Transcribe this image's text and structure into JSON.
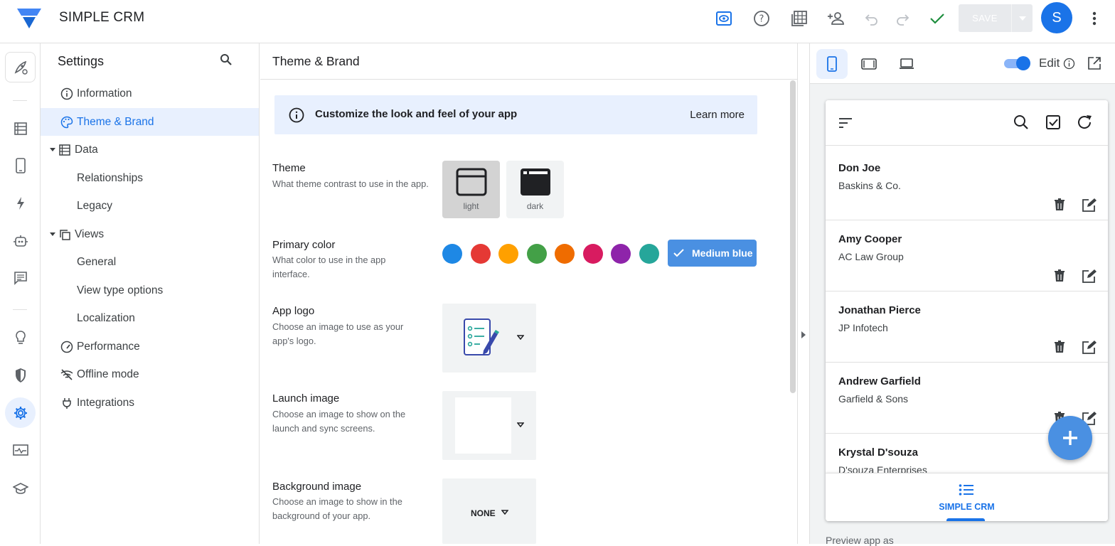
{
  "app": {
    "title": "SIMPLE CRM"
  },
  "toolbar": {
    "save_label": "SAVE",
    "avatar_letter": "S"
  },
  "settings_nav": {
    "title": "Settings",
    "items": [
      {
        "label": "Information",
        "icon": "info-icon"
      },
      {
        "label": "Theme & Brand",
        "icon": "palette-icon",
        "active": true
      },
      {
        "label": "Data",
        "icon": "table-icon",
        "expandable": true
      },
      {
        "label": "Relationships"
      },
      {
        "label": "Legacy"
      },
      {
        "label": "Views",
        "icon": "views-icon",
        "expandable": true
      },
      {
        "label": "General"
      },
      {
        "label": "View type options"
      },
      {
        "label": "Localization"
      },
      {
        "label": "Performance",
        "icon": "speedometer-icon"
      },
      {
        "label": "Offline mode",
        "icon": "wifi-off-icon"
      },
      {
        "label": "Integrations",
        "icon": "plug-icon"
      }
    ]
  },
  "content": {
    "title": "Theme & Brand",
    "banner": {
      "text": "Customize the look and feel of your app",
      "link": "Learn more"
    },
    "theme": {
      "label": "Theme",
      "desc": "What theme contrast to use in the app.",
      "options": [
        {
          "label": "light",
          "selected": true
        },
        {
          "label": "dark"
        }
      ]
    },
    "primary_color": {
      "label": "Primary color",
      "desc": "What color to use in the app interface.",
      "swatches": [
        "#1e88e5",
        "#e53935",
        "#ffa000",
        "#43a047",
        "#ef6c00",
        "#d81b60",
        "#8e24aa",
        "#26a69a"
      ],
      "selected_label": "Medium blue",
      "selected_color": "#4a90e2"
    },
    "app_logo": {
      "label": "App logo",
      "desc": "Choose an image to use as your app's logo."
    },
    "launch_image": {
      "label": "Launch image",
      "desc": "Choose an image to show on the launch and sync screens."
    },
    "background_image": {
      "label": "Background image",
      "desc": "Choose an image to show in the background of your app.",
      "value": "NONE"
    }
  },
  "preview": {
    "edit_label": "Edit",
    "edit_enabled": true,
    "footnote": "Preview app as",
    "rows": [
      {
        "name": "Don Joe",
        "company": "Baskins & Co."
      },
      {
        "name": "Amy Cooper",
        "company": "AC Law Group"
      },
      {
        "name": "Jonathan Pierce",
        "company": "JP Infotech"
      },
      {
        "name": "Andrew Garfield",
        "company": "Garfield & Sons"
      },
      {
        "name": "Krystal D'souza",
        "company": "D'souza Enterprises"
      }
    ],
    "nav_label": "SIMPLE CRM"
  }
}
